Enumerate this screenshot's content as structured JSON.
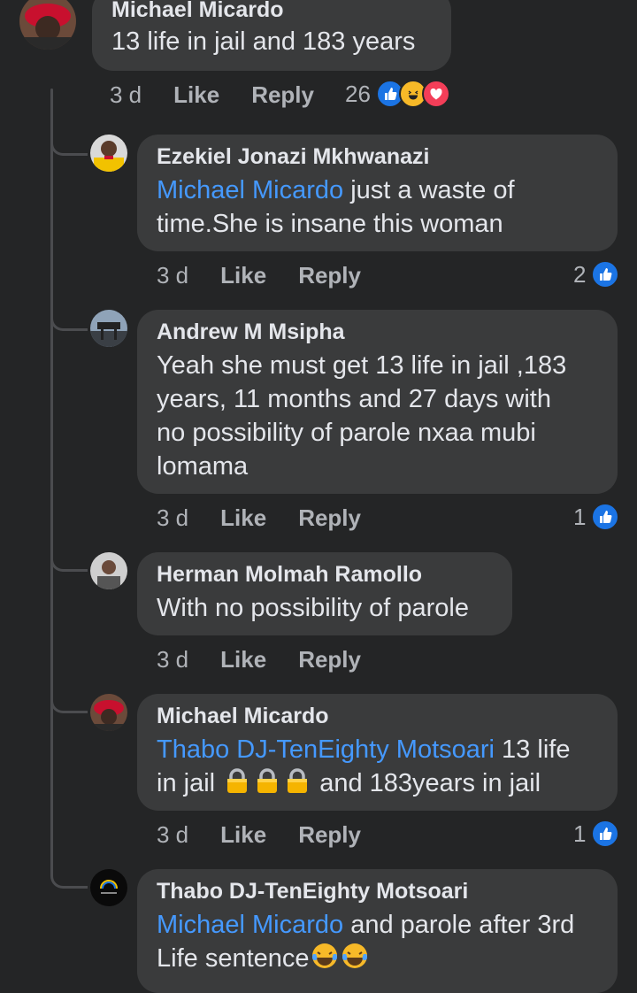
{
  "comments": [
    {
      "author": "Michael Micardo",
      "text": "13 life in jail and 183 years",
      "time": "3 d",
      "like_label": "Like",
      "reply_label": "Reply",
      "reaction_count": "26",
      "reactions": [
        "like-icon",
        "haha-icon",
        "love-icon"
      ]
    },
    {
      "author": "Ezekiel Jonazi Mkhwanazi",
      "mention": "Michael Micardo",
      "text_line1": " just a waste of",
      "text_line2": "time.She is insane this woman",
      "time": "3 d",
      "like_label": "Like",
      "reply_label": "Reply",
      "reaction_count": "2",
      "reactions": [
        "like-icon"
      ]
    },
    {
      "author": "Andrew M Msipha",
      "text_lines": [
        "Yeah she must get 13 life in jail ,183",
        "years, 11 months and 27 days with",
        "no possibility of parole nxaa mubi",
        "lomama"
      ],
      "time": "3 d",
      "like_label": "Like",
      "reply_label": "Reply",
      "reaction_count": "1",
      "reactions": [
        "like-icon"
      ]
    },
    {
      "author": "Herman Molmah Ramollo",
      "text": "With no possibility of parole",
      "time": "3 d",
      "like_label": "Like",
      "reply_label": "Reply"
    },
    {
      "author": "Michael Micardo",
      "mention": "Thabo DJ-TenEighty Motsoari",
      "text_after_mention": " 13 life",
      "text_line2_start": "in jail ",
      "emojis": [
        "lock-icon",
        "lock-icon",
        "lock-icon"
      ],
      "text_line2_end": " and 183years in jail",
      "time": "3 d",
      "like_label": "Like",
      "reply_label": "Reply",
      "reaction_count": "1",
      "reactions": [
        "like-icon"
      ]
    },
    {
      "author": "Thabo DJ-TenEighty Motsoari",
      "mention": "Michael Micardo",
      "text_after_mention": " and parole after 3rd",
      "text_line2": "Life sentence",
      "emojis": [
        "tears-of-joy-icon",
        "tears-of-joy-icon"
      ]
    }
  ],
  "colors": {
    "background": "#242526",
    "bubble": "#3a3b3c",
    "mention": "#4599ff",
    "like_blue": "#1b74e4",
    "haha_yellow": "#f7b928",
    "love_red": "#f33e58"
  }
}
